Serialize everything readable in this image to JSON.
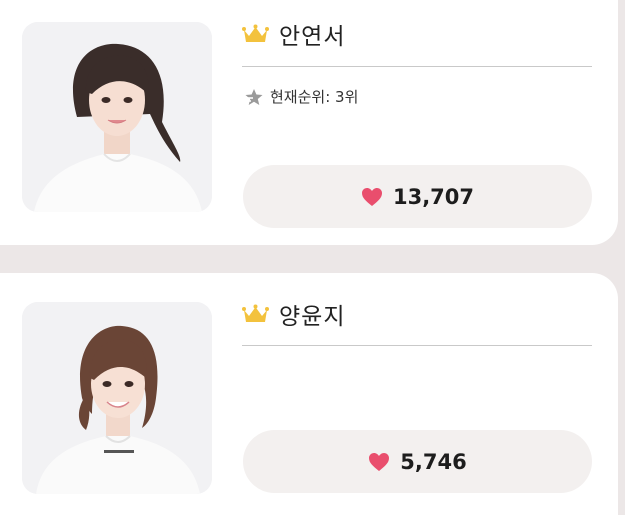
{
  "colors": {
    "background": "#ece7e7",
    "card": "#ffffff",
    "accent_crown": "#f3c23d",
    "heart": "#e94e6d",
    "pill": "#f3f0ef"
  },
  "candidates": [
    {
      "name": "안연서",
      "rank_label": "현재순위: 3위",
      "votes": "13,707",
      "icons": [
        "crown-icon",
        "rank-star-icon",
        "heart-icon"
      ]
    },
    {
      "name": "양윤지",
      "votes": "5,746",
      "icons": [
        "crown-icon",
        "heart-icon"
      ]
    }
  ]
}
